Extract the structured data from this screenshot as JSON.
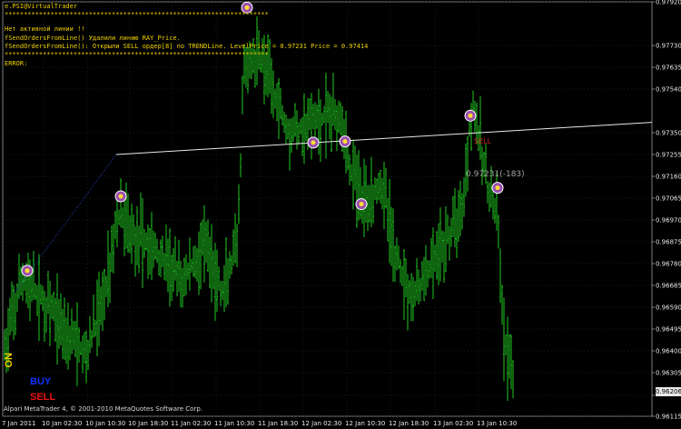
{
  "title_line": "e.PSI@VirtualTrader",
  "separator": "*********************************************************************",
  "log": [
    "Нет активной линии !!",
    "fSendOrdersFromLine() Удалили линию RAY_Price.",
    "fSendOrdersFromLine(): Открыли SELL ордер[8] по TRENDLine. LevelPrice = 0.97231 Price = 0.97414"
  ],
  "error_label": "ERROR:",
  "on_label": "ON",
  "buy_label": "BUY",
  "sell_label": "SELL",
  "copyright": "Alpari MetaTrader 4, © 2001-2010 MetaQuotes Software Corp.",
  "price_tag": "0.97231(-183)",
  "sell_marker": "SELL",
  "last_price": "0.96206",
  "colors": {
    "background": "#000000",
    "bars": "#1fc81f",
    "grid": "#1a4a1a",
    "trendline": "#e8e8e8",
    "log_text": "#f0d000",
    "buy": "#1133ff",
    "sell": "#ee1111"
  },
  "chart_data": {
    "type": "bar",
    "style": "OHLC bars",
    "y_ticks": [
      "0.97920",
      "0.97730",
      "0.97635",
      "0.97540",
      "0.97350",
      "0.97255",
      "0.97160",
      "0.97065",
      "0.96970",
      "0.96875",
      "0.96780",
      "0.96685",
      "0.96590",
      "0.96495",
      "0.96400",
      "0.96305",
      "0.96206",
      "0.96115"
    ],
    "y_tick_values": [
      0.9792,
      0.9773,
      0.97635,
      0.9754,
      0.9735,
      0.97255,
      0.9716,
      0.97065,
      0.9697,
      0.96875,
      0.9678,
      0.96685,
      0.9659,
      0.96495,
      0.964,
      0.96305,
      0.96206,
      0.96115
    ],
    "x_ticks": [
      "7 Jan 2011",
      "10 Jan 02:30",
      "10 Jan 10:30",
      "10 Jan 18:30",
      "11 Jan 02:30",
      "11 Jan 10:30",
      "11 Jan 18:30",
      "12 Jan 02:30",
      "12 Jan 10:30",
      "12 Jan 18:30",
      "13 Jan 02:30",
      "13 Jan 10:30"
    ],
    "ylim": [
      0.96115,
      0.9792
    ],
    "grid": true,
    "trendline": {
      "from_price": 0.97255,
      "to_price": 0.97395
    },
    "order_markers": [
      0.96749,
      0.97073,
      0.97895,
      0.97307,
      0.97312,
      0.97039,
      0.97424,
      0.9711
    ]
  }
}
